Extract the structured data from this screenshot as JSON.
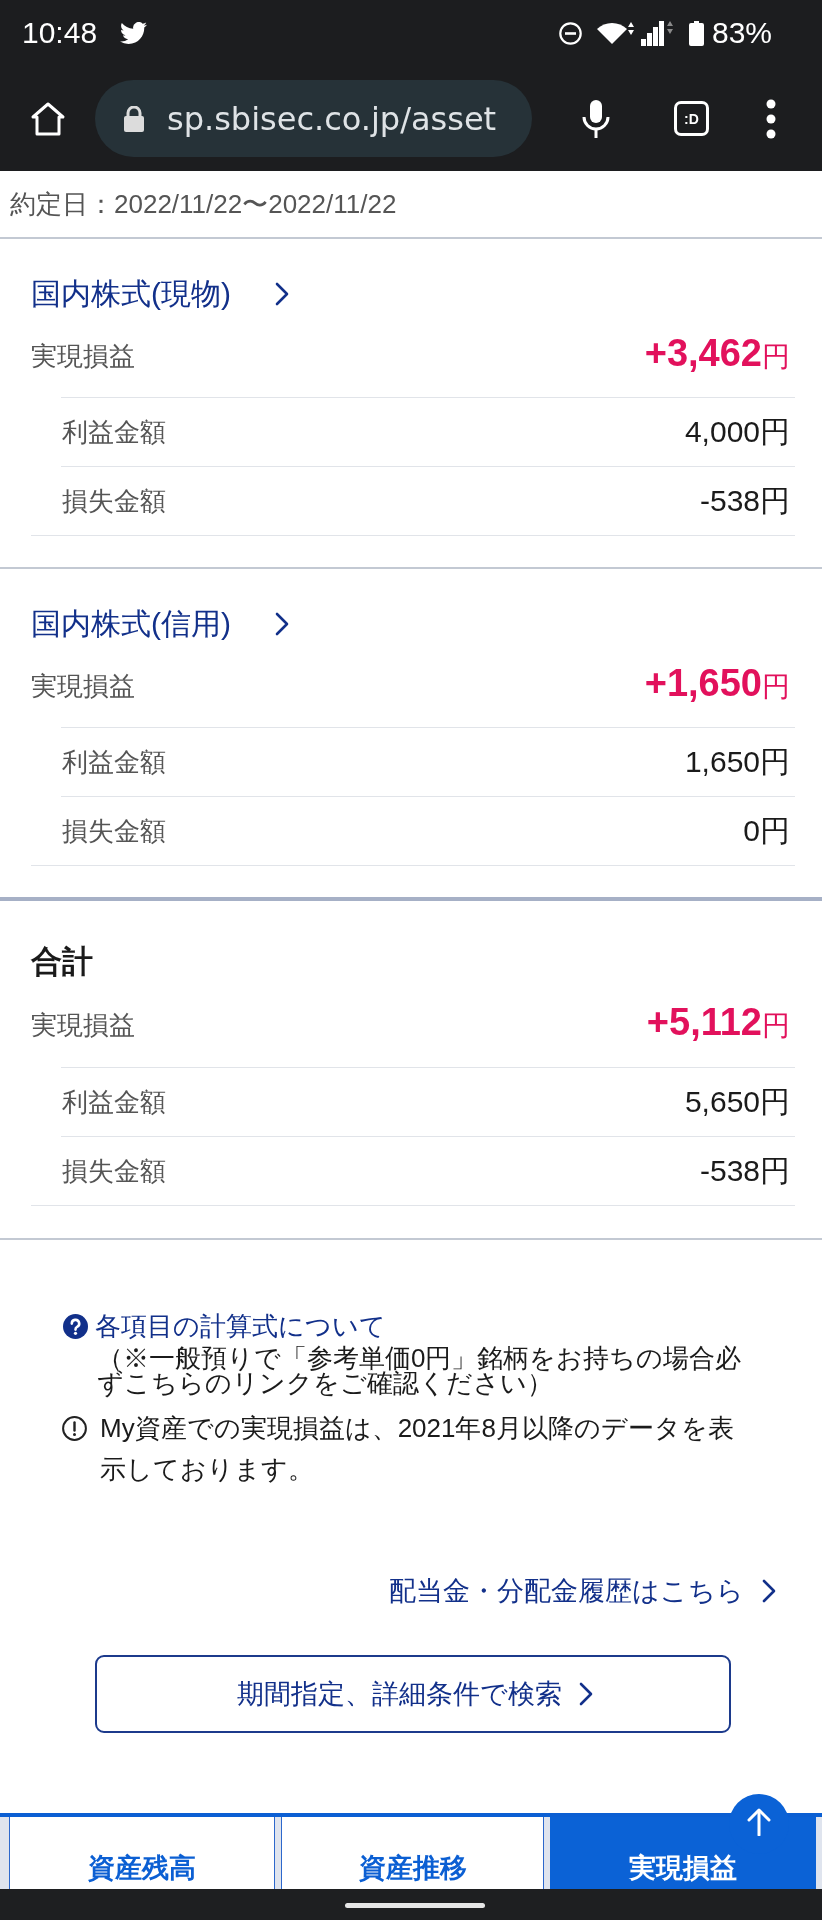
{
  "status_bar": {
    "time": "10:48",
    "battery": "83%"
  },
  "browser": {
    "url": "sp.sbisec.co.jp/asset",
    "tab_count": ":D"
  },
  "period": "約定日：2022/11/22〜2022/11/22",
  "sections": [
    {
      "kind": "link",
      "title": "国内株式(現物)",
      "realized": {
        "label": "実現損益",
        "value": "**+3,462**円"
      },
      "breakdown": [
        {
          "label": "利益金額",
          "value": "4,000円"
        },
        {
          "label": "損失金額",
          "value": "-538円"
        }
      ]
    },
    {
      "kind": "link",
      "title": "国内株式(信用)",
      "realized": {
        "label": "実現損益",
        "value": "**+1,650**円"
      },
      "breakdown": [
        {
          "label": "利益金額",
          "value": "1,650円"
        },
        {
          "label": "損失金額",
          "value": "0円"
        }
      ]
    },
    {
      "kind": "total",
      "title": "合計",
      "realized": {
        "label": "実現損益",
        "value": "**+5,112**円"
      },
      "breakdown": [
        {
          "label": "利益金額",
          "value": "5,650円"
        },
        {
          "label": "損失金額",
          "value": "-538円"
        }
      ]
    }
  ],
  "notes": [
    {
      "kind": "help",
      "link": "各項目の計算式について",
      "text": "（※一般預りで「参考単価0円」銘柄をお持ちの場合必ずこちらのリンクをご確認ください）"
    },
    {
      "kind": "info",
      "text": "My資産での実現損益は、2021年8月以降のデータを表示しております。"
    }
  ],
  "dividend_link": "配当金・分配金履歴はこちら",
  "search_button": "期間指定、詳細条件で検索",
  "tabs": [
    {
      "label": "資産残高",
      "selected": false
    },
    {
      "label": "資産推移",
      "selected": false
    },
    {
      "label": "実現損益",
      "selected": true
    }
  ]
}
